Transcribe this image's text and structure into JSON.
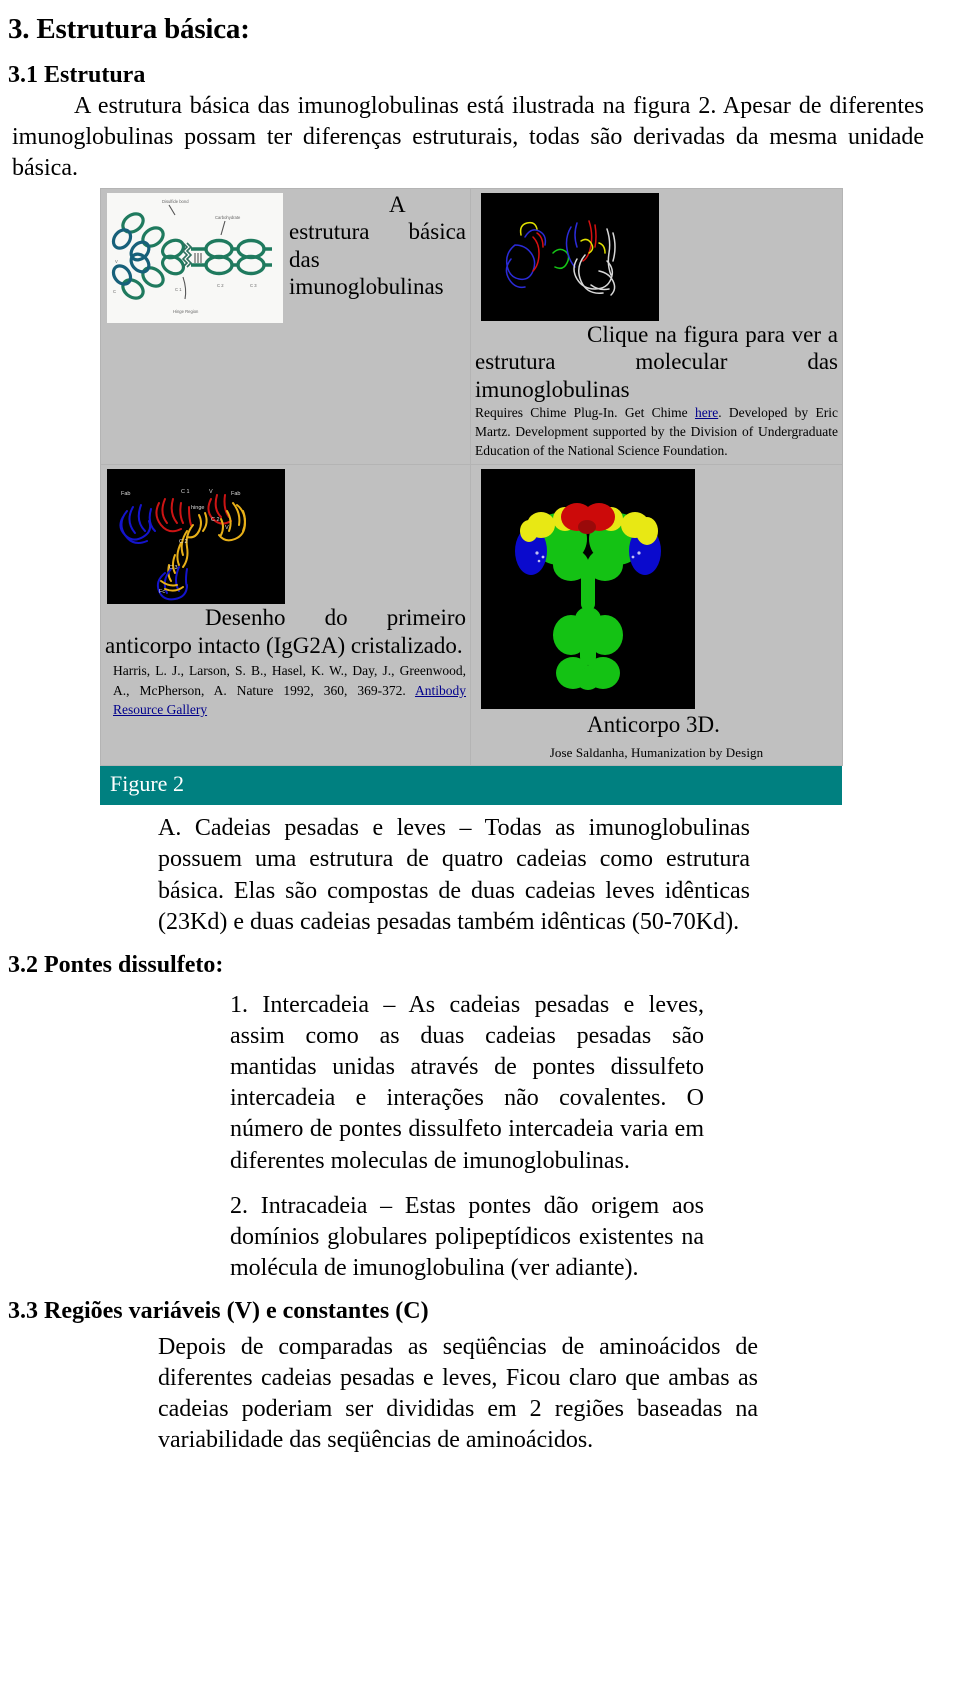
{
  "document": {
    "section_title": "3. Estrutura básica:",
    "subsection_1_title": "3.1 Estrutura",
    "intro_paragraph": "A estrutura básica das imunoglobulinas está ilustrada na figura 2. Apesar de diferentes imunoglobulinas possam ter diferenças estruturais, todas são derivadas da mesma unidade básica.",
    "subsection_2_title": "3.2 Pontes dissulfeto:",
    "subsection_3_title": "3.3 Regiões variáveis (V) e constantes (C)"
  },
  "figure": {
    "cell_schematic": {
      "image_name": "immunoglobulin-schematic-diagram",
      "caption": "A estrutura básica das imunoglobulinas"
    },
    "cell_chime": {
      "image_name": "chime-molecular-structure-thumbnail",
      "caption": "Clique na figura para ver a estrutura molecular das imunoglobulinas",
      "fine_print_a": "Requires Chime Plug-In. Get Chime ",
      "fine_print_link": "here",
      "fine_print_b": ". Developed by Eric Martz. Development supported by the Division of Undergraduate Education of the National Science Foundation."
    },
    "cell_ribbon": {
      "image_name": "igg2a-crystal-ribbon-diagram",
      "caption": "Desenho do primeiro anticorpo intacto (IgG2A) cristalizado.",
      "citation": "Harris, L. J., Larson, S. B., Hasel, K. W., Day, J., Greenwood, A., McPherson, A. Nature 1992, 360, 369-372. ",
      "citation_link": "Antibody Resource Gallery"
    },
    "cell_3d": {
      "image_name": "antibody-3d-space-fill-model",
      "caption": "Anticorpo 3D.",
      "credit": "Jose Saldanha,  Humanization by Design"
    },
    "caption_bar": "Figure 2",
    "caption_bar_color": "#008080"
  },
  "content": {
    "block_a": "A. Cadeias pesadas e leves – Todas as imunoglobulinas possuem uma estrutura de quatro cadeias como estrutura básica. Elas são compostas de duas cadeias leves idênticas (23Kd) e duas cadeias pesadas também idênticas (50-70Kd).",
    "list_item_1": "1. Intercadeia – As cadeias pesadas e leves, assim como as duas cadeias pesadas são mantidas unidas através de pontes dissulfeto intercadeia e interações não covalentes. O número de pontes dissulfeto intercadeia varia em diferentes moleculas de imunoglobulinas.",
    "list_item_2": "2. Intracadeia – Estas pontes dão origem aos domínios globulares polipeptídicos existentes na molécula de imunoglobulina (ver adiante).",
    "block_c": "Depois de comparadas as seqüências de aminoácidos de diferentes cadeias pesadas e leves, Ficou claro que ambas as cadeias poderiam ser divididas em 2 regiões baseadas na variabilidade das seqüências de aminoácidos."
  }
}
